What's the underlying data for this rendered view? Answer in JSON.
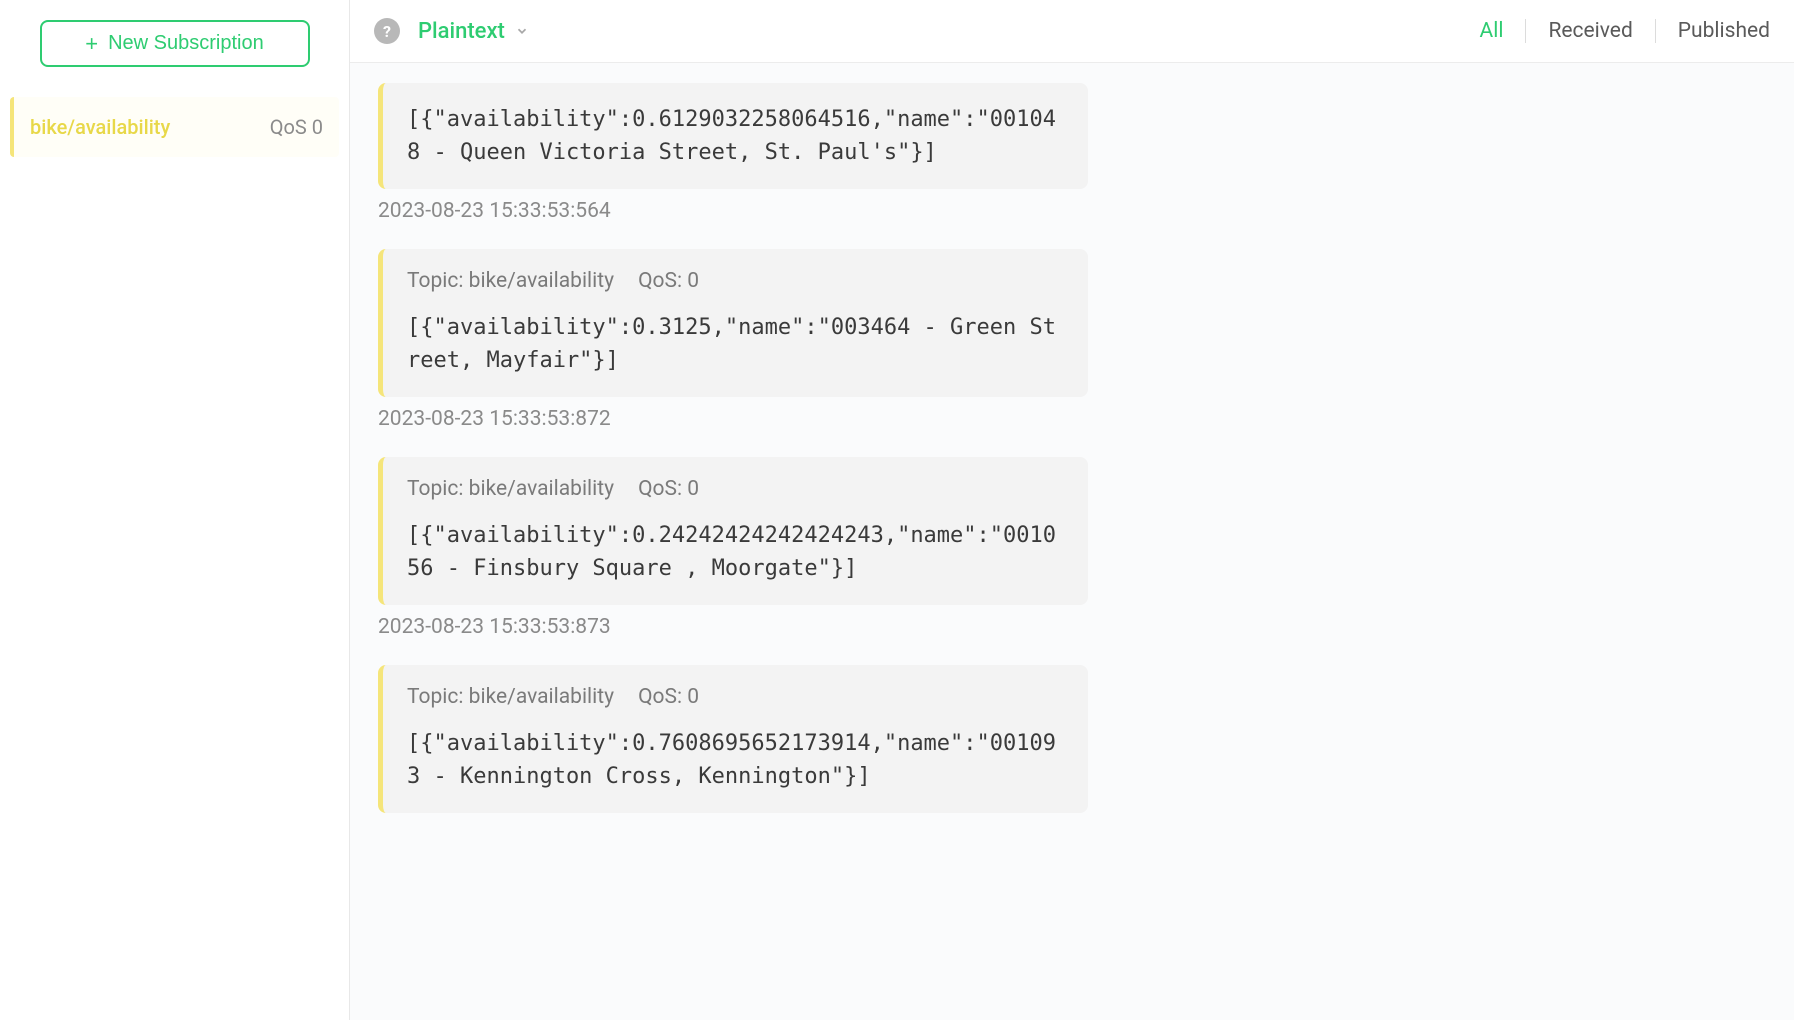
{
  "sidebar": {
    "new_subscription_label": "New Subscription",
    "subscriptions": [
      {
        "topic": "bike/availability",
        "qos": "QoS 0"
      }
    ]
  },
  "topbar": {
    "format_label": "Plaintext",
    "tabs": {
      "all": "All",
      "received": "Received",
      "published": "Published"
    }
  },
  "messages": [
    {
      "topic_label": "",
      "qos_label": "",
      "payload": "[{\"availability\":0.6129032258064516,\"name\":\"001048 - Queen Victoria Street, St. Paul's\"}]",
      "timestamp": "2023-08-23 15:33:53:564",
      "show_meta": false
    },
    {
      "topic_label": "Topic: bike/availability",
      "qos_label": "QoS: 0",
      "payload": "[{\"availability\":0.3125,\"name\":\"003464 - Green Street, Mayfair\"}]",
      "timestamp": "2023-08-23 15:33:53:872",
      "show_meta": true
    },
    {
      "topic_label": "Topic: bike/availability",
      "qos_label": "QoS: 0",
      "payload": "[{\"availability\":0.24242424242424243,\"name\":\"001056 - Finsbury Square , Moorgate\"}]",
      "timestamp": "2023-08-23 15:33:53:873",
      "show_meta": true
    },
    {
      "topic_label": "Topic: bike/availability",
      "qos_label": "QoS: 0",
      "payload": "[{\"availability\":0.7608695652173914,\"name\":\"001093 - Kennington Cross, Kennington\"}]",
      "timestamp": "",
      "show_meta": true
    }
  ]
}
